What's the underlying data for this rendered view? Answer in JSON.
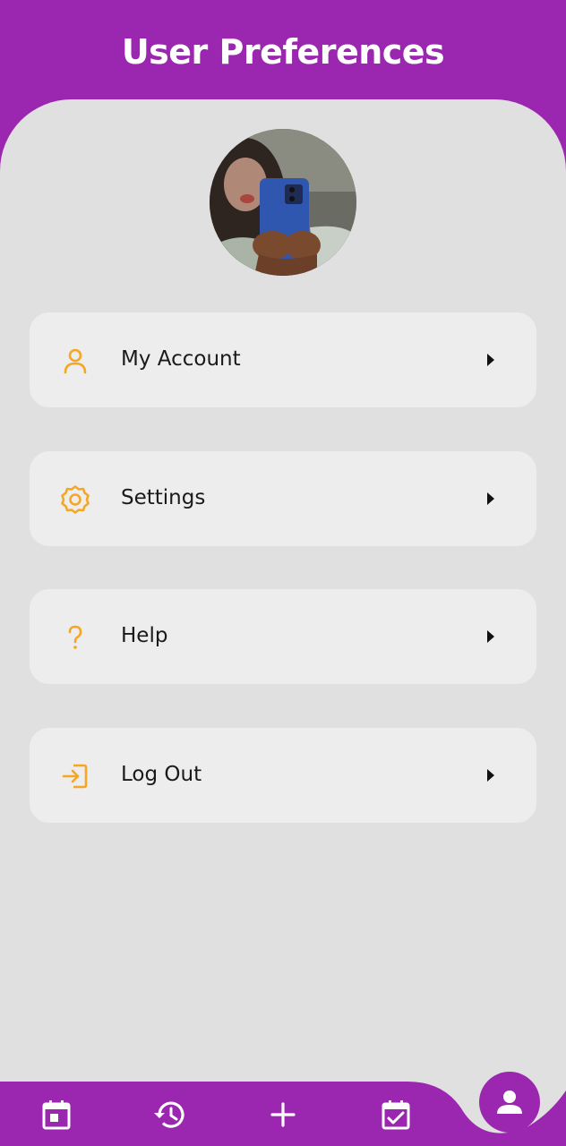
{
  "header": {
    "title": "User Preferences"
  },
  "profile": {
    "avatar_icon": "profile-photo"
  },
  "menu": {
    "items": [
      {
        "label": "My Account",
        "icon": "person-icon"
      },
      {
        "label": "Settings",
        "icon": "gear-icon"
      },
      {
        "label": "Help",
        "icon": "question-icon"
      },
      {
        "label": "Log Out",
        "icon": "logout-icon"
      }
    ]
  },
  "bottom_nav": {
    "items": [
      {
        "icon": "calendar-icon"
      },
      {
        "icon": "history-icon"
      },
      {
        "icon": "add-icon"
      },
      {
        "icon": "calendar-check-icon"
      },
      {
        "icon": "profile-icon",
        "active": true
      }
    ]
  },
  "colors": {
    "primary": "#9b27b0",
    "accent": "#f5a623",
    "panel_bg": "#e0e0e0",
    "card_bg": "#ededed"
  }
}
